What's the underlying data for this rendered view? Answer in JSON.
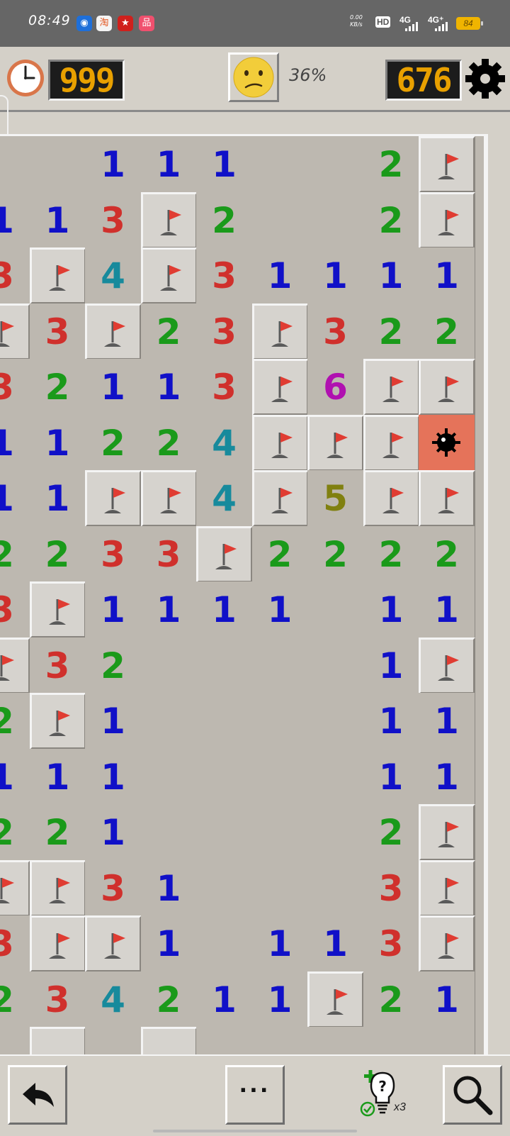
{
  "status_bar": {
    "time": "08:49",
    "apps": [
      {
        "icon": "qq-icon",
        "glyph": "◉",
        "color": "#1e6fd9"
      },
      {
        "icon": "taobao-icon",
        "glyph": "淘",
        "color": "#f4f4f4"
      },
      {
        "icon": "app-red-icon",
        "glyph": "★",
        "color": "#d0201c"
      },
      {
        "icon": "app-pink-icon",
        "glyph": "品",
        "color": "#f0506e"
      }
    ],
    "net_speed": "0.00",
    "net_unit": "KB/s",
    "hd_badge": "HD",
    "signal_1": "4G",
    "signal_2": "4G⁺",
    "battery": "84"
  },
  "top_bar": {
    "timer": "999",
    "mines_remaining": "676",
    "progress": "36%",
    "face": "neutral-face"
  },
  "board": {
    "visible_rows": 17,
    "visible_cols": 9,
    "legend": {
      "": "empty open",
      "1-8": "number",
      "F": "flag",
      "B": "exploded mine",
      "H": "unopened"
    },
    "rows": [
      [
        "",
        "",
        "1",
        "1",
        "1",
        "",
        "",
        "2",
        "F"
      ],
      [
        "1",
        "1",
        "3",
        "F",
        "2",
        "",
        "",
        "2",
        "F"
      ],
      [
        "3",
        "F",
        "4",
        "F",
        "3",
        "1",
        "1",
        "1",
        "1"
      ],
      [
        "F",
        "3",
        "F",
        "2",
        "3",
        "F",
        "3",
        "2",
        "2"
      ],
      [
        "3",
        "2",
        "1",
        "1",
        "3",
        "F",
        "6",
        "F",
        "F"
      ],
      [
        "1",
        "1",
        "2",
        "2",
        "4",
        "F",
        "F",
        "F",
        "B"
      ],
      [
        "1",
        "1",
        "F",
        "F",
        "4",
        "F",
        "5",
        "F",
        "F"
      ],
      [
        "2",
        "2",
        "3",
        "3",
        "F",
        "2",
        "2",
        "2",
        "2"
      ],
      [
        "3",
        "F",
        "1",
        "1",
        "1",
        "1",
        "",
        "1",
        "1"
      ],
      [
        "F",
        "3",
        "2",
        "",
        "",
        "",
        "",
        "1",
        "F"
      ],
      [
        "2",
        "F",
        "1",
        "",
        "",
        "",
        "",
        "1",
        "1"
      ],
      [
        "1",
        "1",
        "1",
        "",
        "",
        "",
        "",
        "1",
        "1"
      ],
      [
        "2",
        "2",
        "1",
        "",
        "",
        "",
        "",
        "2",
        "F"
      ],
      [
        "F",
        "F",
        "3",
        "1",
        "",
        "",
        "",
        "3",
        "F"
      ],
      [
        "3",
        "F",
        "F",
        "1",
        "",
        "1",
        "1",
        "3",
        "F"
      ],
      [
        "2",
        "3",
        "4",
        "2",
        "1",
        "1",
        "F",
        "2",
        "1"
      ],
      [
        "",
        "H",
        "",
        "H",
        "",
        "",
        "",
        "",
        ""
      ]
    ]
  },
  "bottom_bar": {
    "undo_icon": "undo-arrow-icon",
    "more_label": "···",
    "hint_icon": "hint-bulb-icon",
    "hint_count": "x3",
    "search_icon": "magnifier-icon"
  }
}
